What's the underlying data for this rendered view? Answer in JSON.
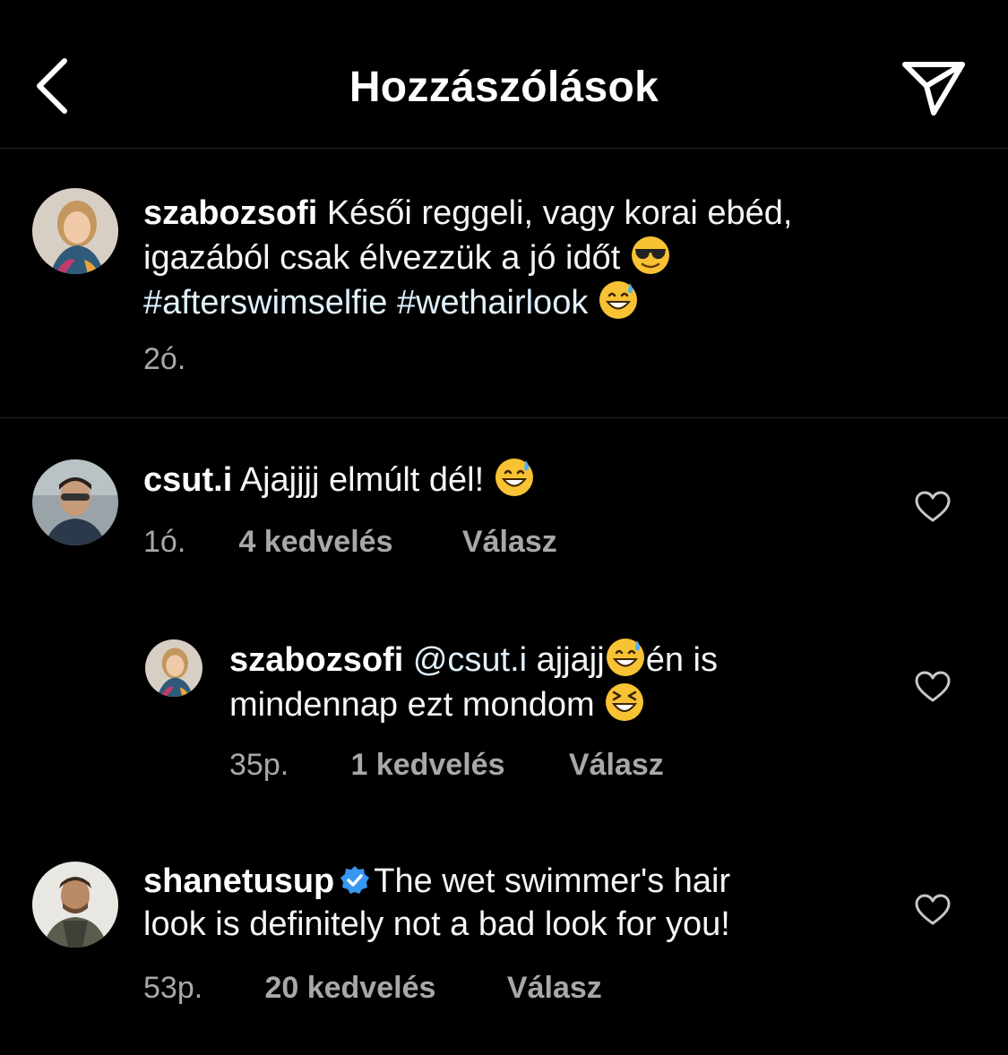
{
  "header": {
    "title": "Hozzászólások"
  },
  "caption": {
    "username": "szabozsofi",
    "line1": "Késői reggeli, vagy korai ebéd,",
    "line2": "igazából csak élvezzük a jó időt",
    "hashtag1": "#afterswimselfie",
    "hashtag2": "#wethairlook",
    "time": "2ó."
  },
  "comments": [
    {
      "username": "csut.i",
      "text": "Ajajjjj elmúlt dél!",
      "time": "1ó.",
      "likes": "4 kedvelés",
      "reply": "Válasz"
    },
    {
      "username": "szabozsofi",
      "mention": "@csut.i",
      "text_a": "ajjajj",
      "text_b": "én is",
      "line2": "mindennap ezt mondom",
      "time": "35p.",
      "likes": "1 kedvelés",
      "reply": "Válasz"
    },
    {
      "username": "shanetusup",
      "line1": "The wet swimmer's hair",
      "line2": "look is definitely not a bad look for you!",
      "time": "53p.",
      "likes": "20 kedvelés",
      "reply": "Válasz"
    }
  ],
  "icons": {
    "back": "chevron-left-icon",
    "send": "paper-plane-icon",
    "like": "heart-outline-icon",
    "verified": "verified-badge-icon"
  },
  "colors": {
    "background": "#000000",
    "text": "#ffffff",
    "secondary": "#a8a8a8",
    "hashtag": "#e0f1ff",
    "verified": "#3897f0"
  }
}
